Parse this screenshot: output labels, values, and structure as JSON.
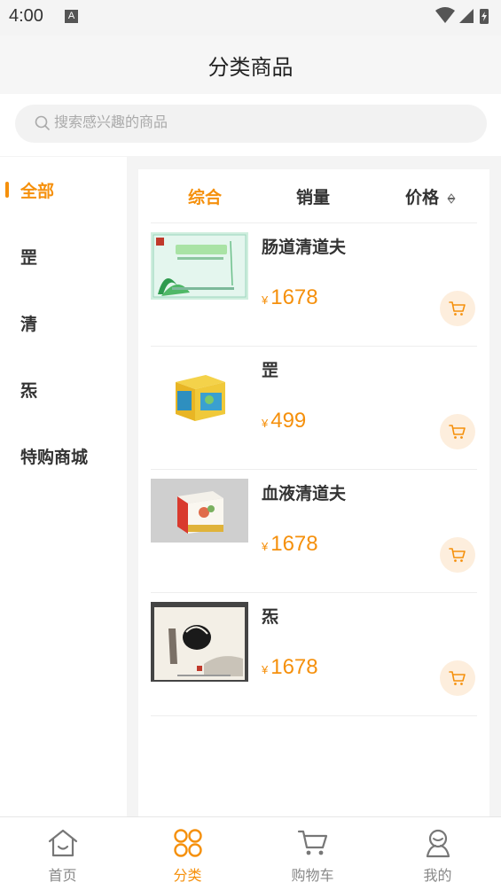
{
  "status_bar": {
    "time": "4:00",
    "notif_letter": "A"
  },
  "header": {
    "title": "分类商品"
  },
  "search": {
    "placeholder": "搜索感兴趣的商品"
  },
  "sidebar": {
    "items": [
      {
        "label": "全部",
        "active": true
      },
      {
        "label": "罡",
        "active": false
      },
      {
        "label": "清",
        "active": false
      },
      {
        "label": "炁",
        "active": false
      },
      {
        "label": "特购商城",
        "active": false
      }
    ]
  },
  "sort": {
    "comprehensive": "综合",
    "sales": "销量",
    "price": "价格"
  },
  "products": [
    {
      "name": "肠道清道夫",
      "currency": "¥",
      "price": "1678"
    },
    {
      "name": "罡",
      "currency": "¥",
      "price": "499"
    },
    {
      "name": "血液清道夫",
      "currency": "¥",
      "price": "1678"
    },
    {
      "name": "炁",
      "currency": "¥",
      "price": "1678"
    }
  ],
  "tabbar": {
    "home": "首页",
    "category": "分类",
    "cart": "购物车",
    "mine": "我的"
  },
  "colors": {
    "accent": "#f5900c",
    "cart_bg": "#fdeedd"
  }
}
